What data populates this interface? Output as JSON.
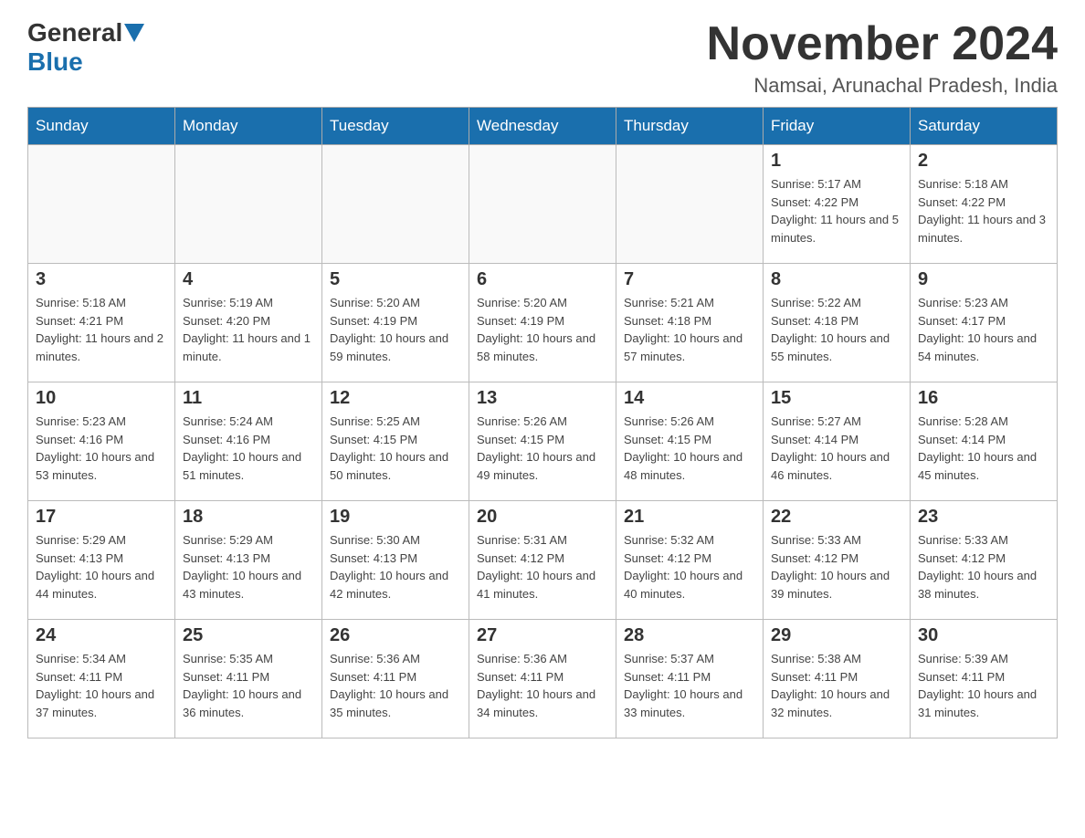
{
  "header": {
    "logo_general": "General",
    "logo_blue": "Blue",
    "month_title": "November 2024",
    "location": "Namsai, Arunachal Pradesh, India"
  },
  "days_of_week": [
    "Sunday",
    "Monday",
    "Tuesday",
    "Wednesday",
    "Thursday",
    "Friday",
    "Saturday"
  ],
  "weeks": [
    [
      {
        "day": "",
        "info": ""
      },
      {
        "day": "",
        "info": ""
      },
      {
        "day": "",
        "info": ""
      },
      {
        "day": "",
        "info": ""
      },
      {
        "day": "",
        "info": ""
      },
      {
        "day": "1",
        "info": "Sunrise: 5:17 AM\nSunset: 4:22 PM\nDaylight: 11 hours and 5 minutes."
      },
      {
        "day": "2",
        "info": "Sunrise: 5:18 AM\nSunset: 4:22 PM\nDaylight: 11 hours and 3 minutes."
      }
    ],
    [
      {
        "day": "3",
        "info": "Sunrise: 5:18 AM\nSunset: 4:21 PM\nDaylight: 11 hours and 2 minutes."
      },
      {
        "day": "4",
        "info": "Sunrise: 5:19 AM\nSunset: 4:20 PM\nDaylight: 11 hours and 1 minute."
      },
      {
        "day": "5",
        "info": "Sunrise: 5:20 AM\nSunset: 4:19 PM\nDaylight: 10 hours and 59 minutes."
      },
      {
        "day": "6",
        "info": "Sunrise: 5:20 AM\nSunset: 4:19 PM\nDaylight: 10 hours and 58 minutes."
      },
      {
        "day": "7",
        "info": "Sunrise: 5:21 AM\nSunset: 4:18 PM\nDaylight: 10 hours and 57 minutes."
      },
      {
        "day": "8",
        "info": "Sunrise: 5:22 AM\nSunset: 4:18 PM\nDaylight: 10 hours and 55 minutes."
      },
      {
        "day": "9",
        "info": "Sunrise: 5:23 AM\nSunset: 4:17 PM\nDaylight: 10 hours and 54 minutes."
      }
    ],
    [
      {
        "day": "10",
        "info": "Sunrise: 5:23 AM\nSunset: 4:16 PM\nDaylight: 10 hours and 53 minutes."
      },
      {
        "day": "11",
        "info": "Sunrise: 5:24 AM\nSunset: 4:16 PM\nDaylight: 10 hours and 51 minutes."
      },
      {
        "day": "12",
        "info": "Sunrise: 5:25 AM\nSunset: 4:15 PM\nDaylight: 10 hours and 50 minutes."
      },
      {
        "day": "13",
        "info": "Sunrise: 5:26 AM\nSunset: 4:15 PM\nDaylight: 10 hours and 49 minutes."
      },
      {
        "day": "14",
        "info": "Sunrise: 5:26 AM\nSunset: 4:15 PM\nDaylight: 10 hours and 48 minutes."
      },
      {
        "day": "15",
        "info": "Sunrise: 5:27 AM\nSunset: 4:14 PM\nDaylight: 10 hours and 46 minutes."
      },
      {
        "day": "16",
        "info": "Sunrise: 5:28 AM\nSunset: 4:14 PM\nDaylight: 10 hours and 45 minutes."
      }
    ],
    [
      {
        "day": "17",
        "info": "Sunrise: 5:29 AM\nSunset: 4:13 PM\nDaylight: 10 hours and 44 minutes."
      },
      {
        "day": "18",
        "info": "Sunrise: 5:29 AM\nSunset: 4:13 PM\nDaylight: 10 hours and 43 minutes."
      },
      {
        "day": "19",
        "info": "Sunrise: 5:30 AM\nSunset: 4:13 PM\nDaylight: 10 hours and 42 minutes."
      },
      {
        "day": "20",
        "info": "Sunrise: 5:31 AM\nSunset: 4:12 PM\nDaylight: 10 hours and 41 minutes."
      },
      {
        "day": "21",
        "info": "Sunrise: 5:32 AM\nSunset: 4:12 PM\nDaylight: 10 hours and 40 minutes."
      },
      {
        "day": "22",
        "info": "Sunrise: 5:33 AM\nSunset: 4:12 PM\nDaylight: 10 hours and 39 minutes."
      },
      {
        "day": "23",
        "info": "Sunrise: 5:33 AM\nSunset: 4:12 PM\nDaylight: 10 hours and 38 minutes."
      }
    ],
    [
      {
        "day": "24",
        "info": "Sunrise: 5:34 AM\nSunset: 4:11 PM\nDaylight: 10 hours and 37 minutes."
      },
      {
        "day": "25",
        "info": "Sunrise: 5:35 AM\nSunset: 4:11 PM\nDaylight: 10 hours and 36 minutes."
      },
      {
        "day": "26",
        "info": "Sunrise: 5:36 AM\nSunset: 4:11 PM\nDaylight: 10 hours and 35 minutes."
      },
      {
        "day": "27",
        "info": "Sunrise: 5:36 AM\nSunset: 4:11 PM\nDaylight: 10 hours and 34 minutes."
      },
      {
        "day": "28",
        "info": "Sunrise: 5:37 AM\nSunset: 4:11 PM\nDaylight: 10 hours and 33 minutes."
      },
      {
        "day": "29",
        "info": "Sunrise: 5:38 AM\nSunset: 4:11 PM\nDaylight: 10 hours and 32 minutes."
      },
      {
        "day": "30",
        "info": "Sunrise: 5:39 AM\nSunset: 4:11 PM\nDaylight: 10 hours and 31 minutes."
      }
    ]
  ]
}
